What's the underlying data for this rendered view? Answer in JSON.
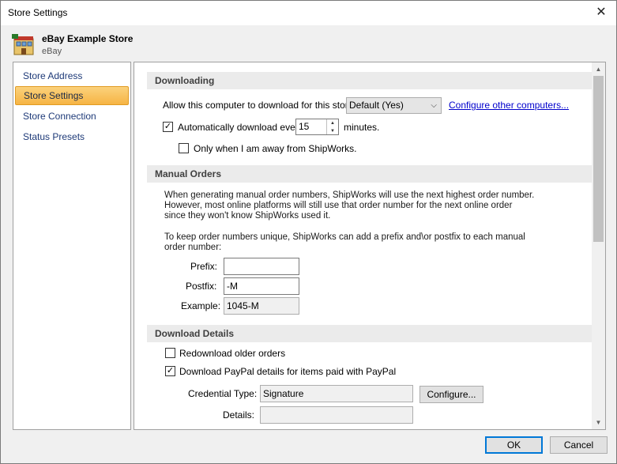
{
  "window": {
    "title": "Store Settings",
    "close_glyph": "✕"
  },
  "store": {
    "name": "eBay Example Store",
    "platform": "eBay",
    "icon": "store-building-icon"
  },
  "sidebar": {
    "items": [
      {
        "label": "Store Address"
      },
      {
        "label": "Store Settings",
        "selected": true
      },
      {
        "label": "Store Connection"
      },
      {
        "label": "Status Presets"
      }
    ]
  },
  "downloading": {
    "header": "Downloading",
    "allow_label": "Allow this computer to download for this store:",
    "allow_value": "Default (Yes)",
    "configure_link": "Configure other computers...",
    "auto_label": "Automatically download every",
    "auto_checked": true,
    "auto_value": "15",
    "minutes_label": "minutes.",
    "away_label": "Only when I am away from ShipWorks.",
    "away_checked": false
  },
  "manual_orders": {
    "header": "Manual Orders",
    "para1": [
      "When generating manual order numbers, ShipWorks will use the next highest order number.",
      "However, most online platforms will still use that order number for the next online order",
      "since they won't know ShipWorks used it."
    ],
    "para2": [
      "To keep order numbers unique, ShipWorks can add a prefix and\\or postfix to each manual",
      "order number:"
    ],
    "prefix_label": "Prefix:",
    "prefix_value": "",
    "postfix_label": "Postfix:",
    "postfix_value": "-M",
    "example_label": "Example:",
    "example_value": "1045-M"
  },
  "download_details": {
    "header": "Download Details",
    "redownload_label": "Redownload older orders",
    "redownload_checked": false,
    "paypal_label": "Download PayPal details for items paid with PayPal",
    "paypal_checked": true,
    "credential_label": "Credential Type:",
    "credential_value": "Signature",
    "configure_button": "Configure...",
    "details_label": "Details:",
    "details_value": ""
  },
  "footer": {
    "ok": "OK",
    "cancel": "Cancel"
  },
  "colors": {
    "accent": "#0078d7",
    "selected_nav": "#f6b444",
    "link": "#0000cc"
  }
}
